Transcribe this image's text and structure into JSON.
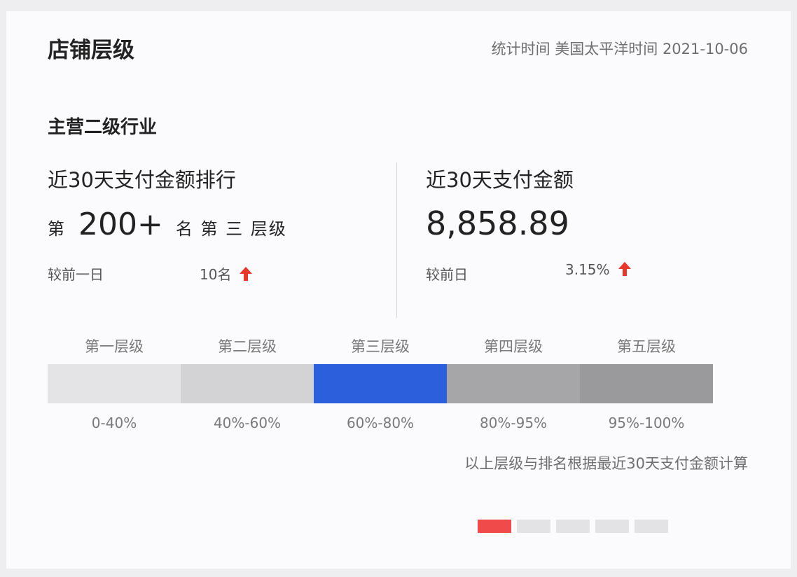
{
  "header": {
    "title": "店铺层级",
    "stat_time": "统计时间 美国太平洋时间 2021-10-06"
  },
  "section": {
    "title": "主营二级行业"
  },
  "rank": {
    "label": "近30天支付金额排行",
    "prefix": "第",
    "value": "200+",
    "suffix": "名 第 三 层级",
    "compare_label": "较前一日",
    "compare_value": "10名",
    "trend": "up-arrow-icon"
  },
  "amount": {
    "label": "近30天支付金额",
    "value": "8,858.89",
    "compare_label": "较前日",
    "compare_value": "3.15%",
    "trend": "up-arrow-icon"
  },
  "tiers": {
    "names": [
      "第一层级",
      "第二层级",
      "第三层级",
      "第四层级",
      "第五层级"
    ],
    "ranges": [
      "0-40%",
      "40%-60%",
      "60%-80%",
      "80%-95%",
      "95%-100%"
    ],
    "colors": [
      "#e4e4e6",
      "#d3d3d5",
      "#2b5fdc",
      "#a6a6a8",
      "#9a9a9c"
    ],
    "current_index": 2
  },
  "note": "以上层级与排名根据最近30天支付金额计算",
  "pager": {
    "count": 5,
    "active_index": 0
  },
  "colors": {
    "accent": "#2b5fdc",
    "trend_up": "#e8382c",
    "pager_active": "#f04a4a"
  }
}
